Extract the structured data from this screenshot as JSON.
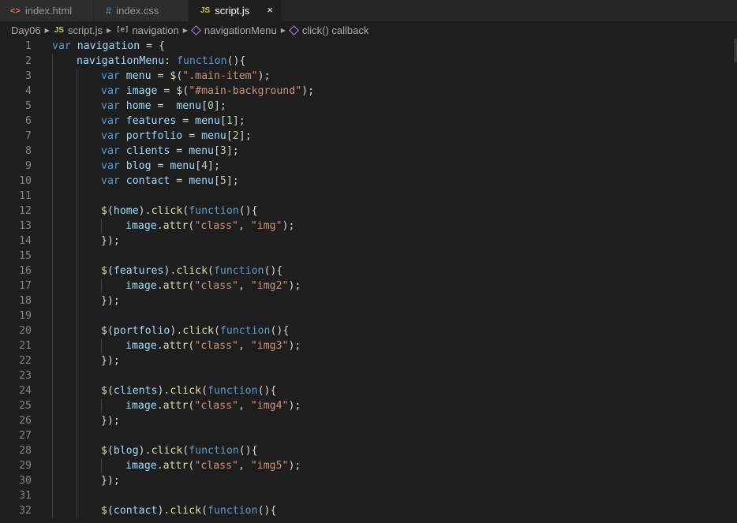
{
  "tabs": [
    {
      "label": "index.html",
      "icon": "html-file-icon",
      "glyph": "<>",
      "active": false
    },
    {
      "label": "index.css",
      "icon": "css-file-icon",
      "glyph": "#",
      "active": false
    },
    {
      "label": "script.js",
      "icon": "js-file-icon",
      "glyph": "JS",
      "active": true
    }
  ],
  "close_glyph": "×",
  "breadcrumbs": {
    "folder": "Day06",
    "file_glyph": "JS",
    "file": "script.js",
    "var_glyph": "[e]",
    "variable": "navigation",
    "method": "navigationMenu",
    "callback": "click() callback"
  },
  "colors": {
    "keyword": "#569cd6",
    "variable": "#9cdcfe",
    "function": "#dcdcaa",
    "string": "#ce9178",
    "number": "#b5cea8",
    "plain": "#d4d4d4",
    "line_number": "#858585",
    "background": "#1e1e1e"
  },
  "code_lines": [
    {
      "n": "1",
      "indent": 0,
      "tokens": [
        [
          "kw",
          "var"
        ],
        [
          "pl",
          " "
        ],
        [
          "vr",
          "navigation"
        ],
        [
          "pl",
          " = {"
        ]
      ]
    },
    {
      "n": "2",
      "indent": 1,
      "tokens": [
        [
          "vr",
          "navigationMenu"
        ],
        [
          "pl",
          ": "
        ],
        [
          "kw",
          "function"
        ],
        [
          "pl",
          "(){"
        ]
      ]
    },
    {
      "n": "3",
      "indent": 2,
      "tokens": [
        [
          "kw",
          "var"
        ],
        [
          "pl",
          " "
        ],
        [
          "vr",
          "menu"
        ],
        [
          "pl",
          " = "
        ],
        [
          "fn",
          "$"
        ],
        [
          "pl",
          "("
        ],
        [
          "st",
          "\".main-item\""
        ],
        [
          "pl",
          ");"
        ]
      ]
    },
    {
      "n": "4",
      "indent": 2,
      "tokens": [
        [
          "kw",
          "var"
        ],
        [
          "pl",
          " "
        ],
        [
          "vr",
          "image"
        ],
        [
          "pl",
          " = "
        ],
        [
          "fn",
          "$"
        ],
        [
          "pl",
          "("
        ],
        [
          "st",
          "\"#main-background\""
        ],
        [
          "pl",
          ");"
        ]
      ]
    },
    {
      "n": "5",
      "indent": 2,
      "tokens": [
        [
          "kw",
          "var"
        ],
        [
          "pl",
          " "
        ],
        [
          "vr",
          "home"
        ],
        [
          "pl",
          " =  "
        ],
        [
          "vr",
          "menu"
        ],
        [
          "pl",
          "["
        ],
        [
          "nm",
          "0"
        ],
        [
          "pl",
          "];"
        ]
      ]
    },
    {
      "n": "6",
      "indent": 2,
      "tokens": [
        [
          "kw",
          "var"
        ],
        [
          "pl",
          " "
        ],
        [
          "vr",
          "features"
        ],
        [
          "pl",
          " = "
        ],
        [
          "vr",
          "menu"
        ],
        [
          "pl",
          "["
        ],
        [
          "nm",
          "1"
        ],
        [
          "pl",
          "];"
        ]
      ]
    },
    {
      "n": "7",
      "indent": 2,
      "tokens": [
        [
          "kw",
          "var"
        ],
        [
          "pl",
          " "
        ],
        [
          "vr",
          "portfolio"
        ],
        [
          "pl",
          " = "
        ],
        [
          "vr",
          "menu"
        ],
        [
          "pl",
          "["
        ],
        [
          "nm",
          "2"
        ],
        [
          "pl",
          "];"
        ]
      ]
    },
    {
      "n": "8",
      "indent": 2,
      "tokens": [
        [
          "kw",
          "var"
        ],
        [
          "pl",
          " "
        ],
        [
          "vr",
          "clients"
        ],
        [
          "pl",
          " = "
        ],
        [
          "vr",
          "menu"
        ],
        [
          "pl",
          "["
        ],
        [
          "nm",
          "3"
        ],
        [
          "pl",
          "];"
        ]
      ]
    },
    {
      "n": "9",
      "indent": 2,
      "tokens": [
        [
          "kw",
          "var"
        ],
        [
          "pl",
          " "
        ],
        [
          "vr",
          "blog"
        ],
        [
          "pl",
          " = "
        ],
        [
          "vr",
          "menu"
        ],
        [
          "pl",
          "["
        ],
        [
          "nm",
          "4"
        ],
        [
          "pl",
          "];"
        ]
      ]
    },
    {
      "n": "10",
      "indent": 2,
      "tokens": [
        [
          "kw",
          "var"
        ],
        [
          "pl",
          " "
        ],
        [
          "vr",
          "contact"
        ],
        [
          "pl",
          " = "
        ],
        [
          "vr",
          "menu"
        ],
        [
          "pl",
          "["
        ],
        [
          "nm",
          "5"
        ],
        [
          "pl",
          "];"
        ]
      ]
    },
    {
      "n": "11",
      "indent": 2,
      "tokens": []
    },
    {
      "n": "12",
      "indent": 2,
      "tokens": [
        [
          "fn",
          "$"
        ],
        [
          "pl",
          "("
        ],
        [
          "vr",
          "home"
        ],
        [
          "pl",
          ")."
        ],
        [
          "fn",
          "click"
        ],
        [
          "pl",
          "("
        ],
        [
          "kw",
          "function"
        ],
        [
          "pl",
          "(){"
        ]
      ]
    },
    {
      "n": "13",
      "indent": 3,
      "tokens": [
        [
          "vr",
          "image"
        ],
        [
          "pl",
          "."
        ],
        [
          "fn",
          "attr"
        ],
        [
          "pl",
          "("
        ],
        [
          "st",
          "\"class\""
        ],
        [
          "pl",
          ", "
        ],
        [
          "st",
          "\"img\""
        ],
        [
          "pl",
          ");"
        ]
      ]
    },
    {
      "n": "14",
      "indent": 2,
      "tokens": [
        [
          "pl",
          "});"
        ]
      ]
    },
    {
      "n": "15",
      "indent": 2,
      "tokens": []
    },
    {
      "n": "16",
      "indent": 2,
      "tokens": [
        [
          "fn",
          "$"
        ],
        [
          "pl",
          "("
        ],
        [
          "vr",
          "features"
        ],
        [
          "pl",
          ")."
        ],
        [
          "fn",
          "click"
        ],
        [
          "pl",
          "("
        ],
        [
          "kw",
          "function"
        ],
        [
          "pl",
          "(){"
        ]
      ]
    },
    {
      "n": "17",
      "indent": 3,
      "tokens": [
        [
          "vr",
          "image"
        ],
        [
          "pl",
          "."
        ],
        [
          "fn",
          "attr"
        ],
        [
          "pl",
          "("
        ],
        [
          "st",
          "\"class\""
        ],
        [
          "pl",
          ", "
        ],
        [
          "st",
          "\"img2\""
        ],
        [
          "pl",
          ");"
        ]
      ]
    },
    {
      "n": "18",
      "indent": 2,
      "tokens": [
        [
          "pl",
          "});"
        ]
      ]
    },
    {
      "n": "19",
      "indent": 2,
      "tokens": []
    },
    {
      "n": "20",
      "indent": 2,
      "tokens": [
        [
          "fn",
          "$"
        ],
        [
          "pl",
          "("
        ],
        [
          "vr",
          "portfolio"
        ],
        [
          "pl",
          ")."
        ],
        [
          "fn",
          "click"
        ],
        [
          "pl",
          "("
        ],
        [
          "kw",
          "function"
        ],
        [
          "pl",
          "(){"
        ]
      ]
    },
    {
      "n": "21",
      "indent": 3,
      "tokens": [
        [
          "vr",
          "image"
        ],
        [
          "pl",
          "."
        ],
        [
          "fn",
          "attr"
        ],
        [
          "pl",
          "("
        ],
        [
          "st",
          "\"class\""
        ],
        [
          "pl",
          ", "
        ],
        [
          "st",
          "\"img3\""
        ],
        [
          "pl",
          ");"
        ]
      ]
    },
    {
      "n": "22",
      "indent": 2,
      "tokens": [
        [
          "pl",
          "});"
        ]
      ]
    },
    {
      "n": "23",
      "indent": 2,
      "tokens": []
    },
    {
      "n": "24",
      "indent": 2,
      "tokens": [
        [
          "fn",
          "$"
        ],
        [
          "pl",
          "("
        ],
        [
          "vr",
          "clients"
        ],
        [
          "pl",
          ")."
        ],
        [
          "fn",
          "click"
        ],
        [
          "pl",
          "("
        ],
        [
          "kw",
          "function"
        ],
        [
          "pl",
          "(){"
        ]
      ]
    },
    {
      "n": "25",
      "indent": 3,
      "tokens": [
        [
          "vr",
          "image"
        ],
        [
          "pl",
          "."
        ],
        [
          "fn",
          "attr"
        ],
        [
          "pl",
          "("
        ],
        [
          "st",
          "\"class\""
        ],
        [
          "pl",
          ", "
        ],
        [
          "st",
          "\"img4\""
        ],
        [
          "pl",
          ");"
        ]
      ]
    },
    {
      "n": "26",
      "indent": 2,
      "tokens": [
        [
          "pl",
          "});"
        ]
      ]
    },
    {
      "n": "27",
      "indent": 2,
      "tokens": []
    },
    {
      "n": "28",
      "indent": 2,
      "tokens": [
        [
          "fn",
          "$"
        ],
        [
          "pl",
          "("
        ],
        [
          "vr",
          "blog"
        ],
        [
          "pl",
          ")."
        ],
        [
          "fn",
          "click"
        ],
        [
          "pl",
          "("
        ],
        [
          "kw",
          "function"
        ],
        [
          "pl",
          "(){"
        ]
      ]
    },
    {
      "n": "29",
      "indent": 3,
      "tokens": [
        [
          "vr",
          "image"
        ],
        [
          "pl",
          "."
        ],
        [
          "fn",
          "attr"
        ],
        [
          "pl",
          "("
        ],
        [
          "st",
          "\"class\""
        ],
        [
          "pl",
          ", "
        ],
        [
          "st",
          "\"img5\""
        ],
        [
          "pl",
          ");"
        ]
      ]
    },
    {
      "n": "30",
      "indent": 2,
      "tokens": [
        [
          "pl",
          "});"
        ]
      ]
    },
    {
      "n": "31",
      "indent": 2,
      "tokens": []
    },
    {
      "n": "32",
      "indent": 2,
      "tokens": [
        [
          "fn",
          "$"
        ],
        [
          "pl",
          "("
        ],
        [
          "vr",
          "contact"
        ],
        [
          "pl",
          ")."
        ],
        [
          "fn",
          "click"
        ],
        [
          "pl",
          "("
        ],
        [
          "kw",
          "function"
        ],
        [
          "pl",
          "(){"
        ]
      ]
    }
  ]
}
